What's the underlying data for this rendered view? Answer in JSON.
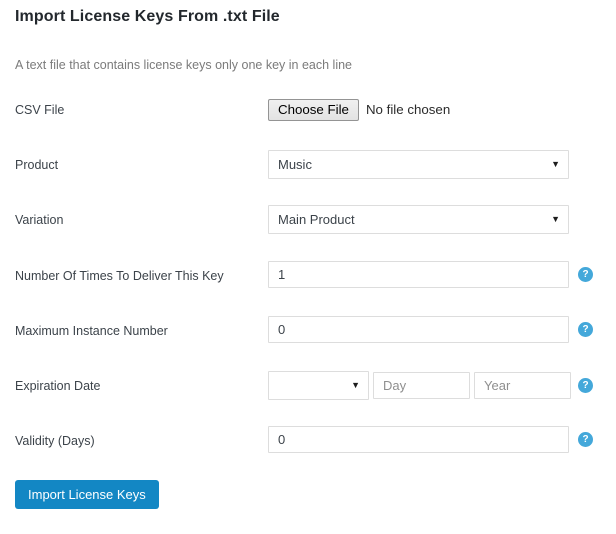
{
  "header": {
    "title": "Import License Keys From .txt File",
    "subtitle": "A text file that contains license keys only one key in each line"
  },
  "form": {
    "csv_file": {
      "label": "CSV File",
      "button_label": "Choose File",
      "status_text": "No file chosen"
    },
    "product": {
      "label": "Product",
      "value": "Music",
      "arrow": "▼"
    },
    "variation": {
      "label": "Variation",
      "value": "Main Product",
      "arrow": "▼"
    },
    "deliver_times": {
      "label": "Number Of Times To Deliver This Key",
      "value": "1",
      "help": "?"
    },
    "max_instance": {
      "label": "Maximum Instance Number",
      "value": "0",
      "help": "?"
    },
    "expiration_date": {
      "label": "Expiration Date",
      "month_value": "",
      "month_arrow": "▼",
      "day_placeholder": "Day",
      "day_value": "",
      "year_placeholder": "Year",
      "year_value": "",
      "help": "?"
    },
    "validity_days": {
      "label": "Validity (Days)",
      "value": "0",
      "help": "?"
    }
  },
  "actions": {
    "submit_label": "Import License Keys"
  },
  "colors": {
    "accent": "#1387c4",
    "help_icon": "#44a8da",
    "title": "#23282d",
    "subtitle": "#7b7b7b",
    "border": "#dddddd"
  }
}
